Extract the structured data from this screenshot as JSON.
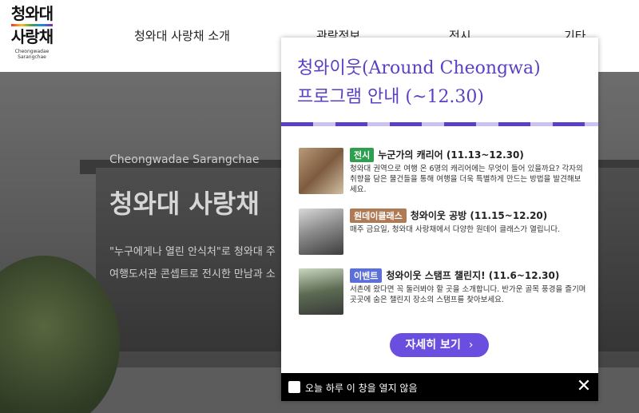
{
  "header": {
    "logo": {
      "main_line1": "청와대",
      "main_line2": "사랑채",
      "sub": "Cheongwadae Sarangchae"
    },
    "nav": [
      "청와대 사랑채 소개",
      "관람정보",
      "전시",
      "기타"
    ]
  },
  "hero": {
    "subtitle": "Cheongwadae Sarangchae",
    "title": "청와대 사랑채",
    "desc_line1": "\"누구에게나 열린 안식처\"로 청와대 주",
    "desc_line2": "여행도서관 콘셉트로 전시한 만남과 소"
  },
  "popup": {
    "title_line1": "청와이웃(Around Cheongwa)",
    "title_line2": "프로그램 안내 (~12.30)",
    "items": [
      {
        "tag": "전시",
        "tag_color": "#2e9e4f",
        "title": "누군가의 캐리어 (11.13~12.30)",
        "desc": "청와대 권역으로 여행 온 6명의 캐리어에는 무엇이 들어 있을까요? 각자의 취향을 담은 물건들을 통해 여행을 더욱 특별하게 만드는 방법을 발견해보세요."
      },
      {
        "tag": "원데이클래스",
        "tag_color": "#b07a55",
        "title": "청와이웃 공방 (11.15~12.20)",
        "desc": "매주 금요일, 청와대 사랑채에서 다양한 원데이 클래스가 열립니다."
      },
      {
        "tag": "이벤트",
        "tag_color": "#5b6fd6",
        "title": "청와이웃 스탬프 챌린지! (11.6~12.30)",
        "desc": "서촌에 왔다면 꼭 둘러봐야 할 곳을 소개합니다. 반가운 골목 풍경을 즐기며 곳곳에 숨은 챌린지 장소의 스탬프를 찾아보세요."
      }
    ],
    "button_label": "자세히 보기",
    "footer_label": "오늘 하루 이 창을 열지 않음"
  },
  "icons": {
    "chevron": "chevron-right-icon",
    "close": "close-icon"
  },
  "colors": {
    "accent": "#5b3fc4",
    "button": "#6a4ee0"
  }
}
